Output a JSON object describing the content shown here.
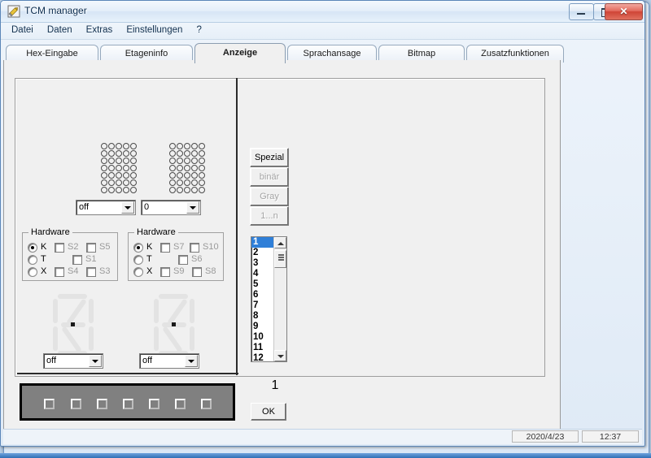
{
  "window": {
    "title": "TCM manager",
    "icon": "app-pencil-icon",
    "controls": {
      "minimize": "–",
      "maximize": "□",
      "close": "✕"
    }
  },
  "menu": {
    "items": [
      "Datei",
      "Daten",
      "Extras",
      "Einstellungen",
      "?"
    ]
  },
  "tabs": {
    "active": "Anzeige",
    "items": [
      {
        "label": "Hex-Eingabe",
        "active": false
      },
      {
        "label": "Etageninfo",
        "active": false
      },
      {
        "label": "Anzeige",
        "active": true
      },
      {
        "label": "Sprachansage",
        "active": false
      },
      {
        "label": "Bitmap",
        "active": false
      },
      {
        "label": "Zusatzfunktionen",
        "active": false
      }
    ]
  },
  "left_panel": {
    "matrix_display": {
      "columns": 5,
      "rows": 7,
      "count": 2,
      "selector_left": {
        "value": "off",
        "label": "matrix-left-mode"
      },
      "selector_right": {
        "value": "0",
        "label": "matrix-right-mode"
      }
    },
    "hardware_groups": [
      {
        "legend": "Hardware",
        "radios": [
          {
            "label": "K",
            "selected": true
          },
          {
            "label": "T",
            "selected": false
          },
          {
            "label": "X",
            "selected": false
          }
        ],
        "checkboxes": [
          {
            "label": "S2",
            "checked": false
          },
          {
            "label": "S5",
            "checked": false
          },
          {
            "label": "S1",
            "checked": false
          },
          {
            "label": "S4",
            "checked": false
          },
          {
            "label": "S3",
            "checked": false
          }
        ]
      },
      {
        "legend": "Hardware",
        "radios": [
          {
            "label": "K",
            "selected": true
          },
          {
            "label": "T",
            "selected": false
          },
          {
            "label": "X",
            "selected": false
          }
        ],
        "checkboxes": [
          {
            "label": "S7",
            "checked": false
          },
          {
            "label": "S10",
            "checked": false
          },
          {
            "label": "S6",
            "checked": false
          },
          {
            "label": "S9",
            "checked": false
          },
          {
            "label": "S8",
            "checked": false
          }
        ]
      }
    ],
    "segment_displays": {
      "type": "14-segment",
      "count": 2,
      "state": "off",
      "selector_left": {
        "value": "off"
      },
      "selector_right": {
        "value": "off"
      }
    },
    "indicator_panel": {
      "lamp_count": 7,
      "background_color": "#808080",
      "border_color": "#000000"
    }
  },
  "right_panel": {
    "mode_buttons": [
      {
        "label": "Spezial",
        "enabled": true
      },
      {
        "label": "binär",
        "enabled": false
      },
      {
        "label": "Gray",
        "enabled": false
      },
      {
        "label": "1...n",
        "enabled": false
      }
    ],
    "list": {
      "selected": "1",
      "items": [
        "1",
        "2",
        "3",
        "4",
        "5",
        "6",
        "7",
        "8",
        "9",
        "10",
        "11",
        "12"
      ]
    },
    "value_display": "1",
    "ok_button": "OK"
  },
  "status_bar": {
    "date": "2020/4/23",
    "time": "12:37"
  },
  "background_window": {
    "logo": "company-logo-icon",
    "combo_value": ""
  },
  "colors": {
    "selection_blue": "#2f7fd8",
    "panel_gray": "#f0f0f0",
    "dark_panel": "#808080",
    "disabled_text": "#a4a4a4",
    "title_blue": "#0b2c4f"
  }
}
